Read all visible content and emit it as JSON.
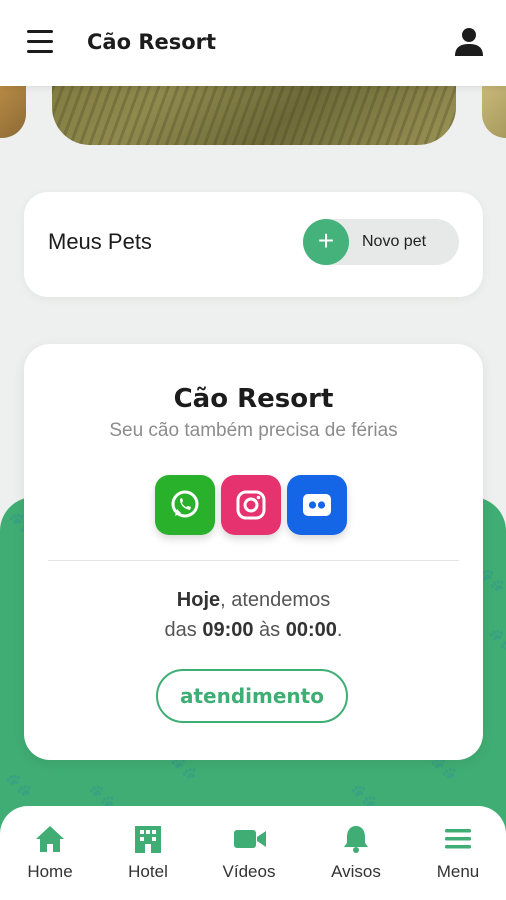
{
  "header": {
    "title": "Cão Resort",
    "menu_icon": "hamburger-icon",
    "profile_icon": "user-icon"
  },
  "pets": {
    "title": "Meus Pets",
    "new_pet_label": "Novo pet",
    "new_pet_icon": "plus-icon"
  },
  "info": {
    "title": "Cão Resort",
    "subtitle": "Seu cão também precisa de férias",
    "social": [
      {
        "name": "whatsapp-icon",
        "color": "#29b12c"
      },
      {
        "name": "instagram-icon",
        "color": "#e6336f"
      },
      {
        "name": "flickr-icon",
        "color": "#1466e6"
      }
    ],
    "hours_today": "Hoje",
    "hours_text1": ", atendemos",
    "hours_prefix": "das ",
    "hours_open": "09:00",
    "hours_mid": " às ",
    "hours_close": "00:00",
    "hours_end": ".",
    "button_label": "atendimento"
  },
  "nav": [
    {
      "label": "Home",
      "icon": "home-icon"
    },
    {
      "label": "Hotel",
      "icon": "hotel-icon"
    },
    {
      "label": "Vídeos",
      "icon": "video-icon"
    },
    {
      "label": "Avisos",
      "icon": "bell-icon"
    },
    {
      "label": "Menu",
      "icon": "menu-icon"
    }
  ],
  "colors": {
    "accent": "#40ad74",
    "background": "#eef0ef"
  }
}
